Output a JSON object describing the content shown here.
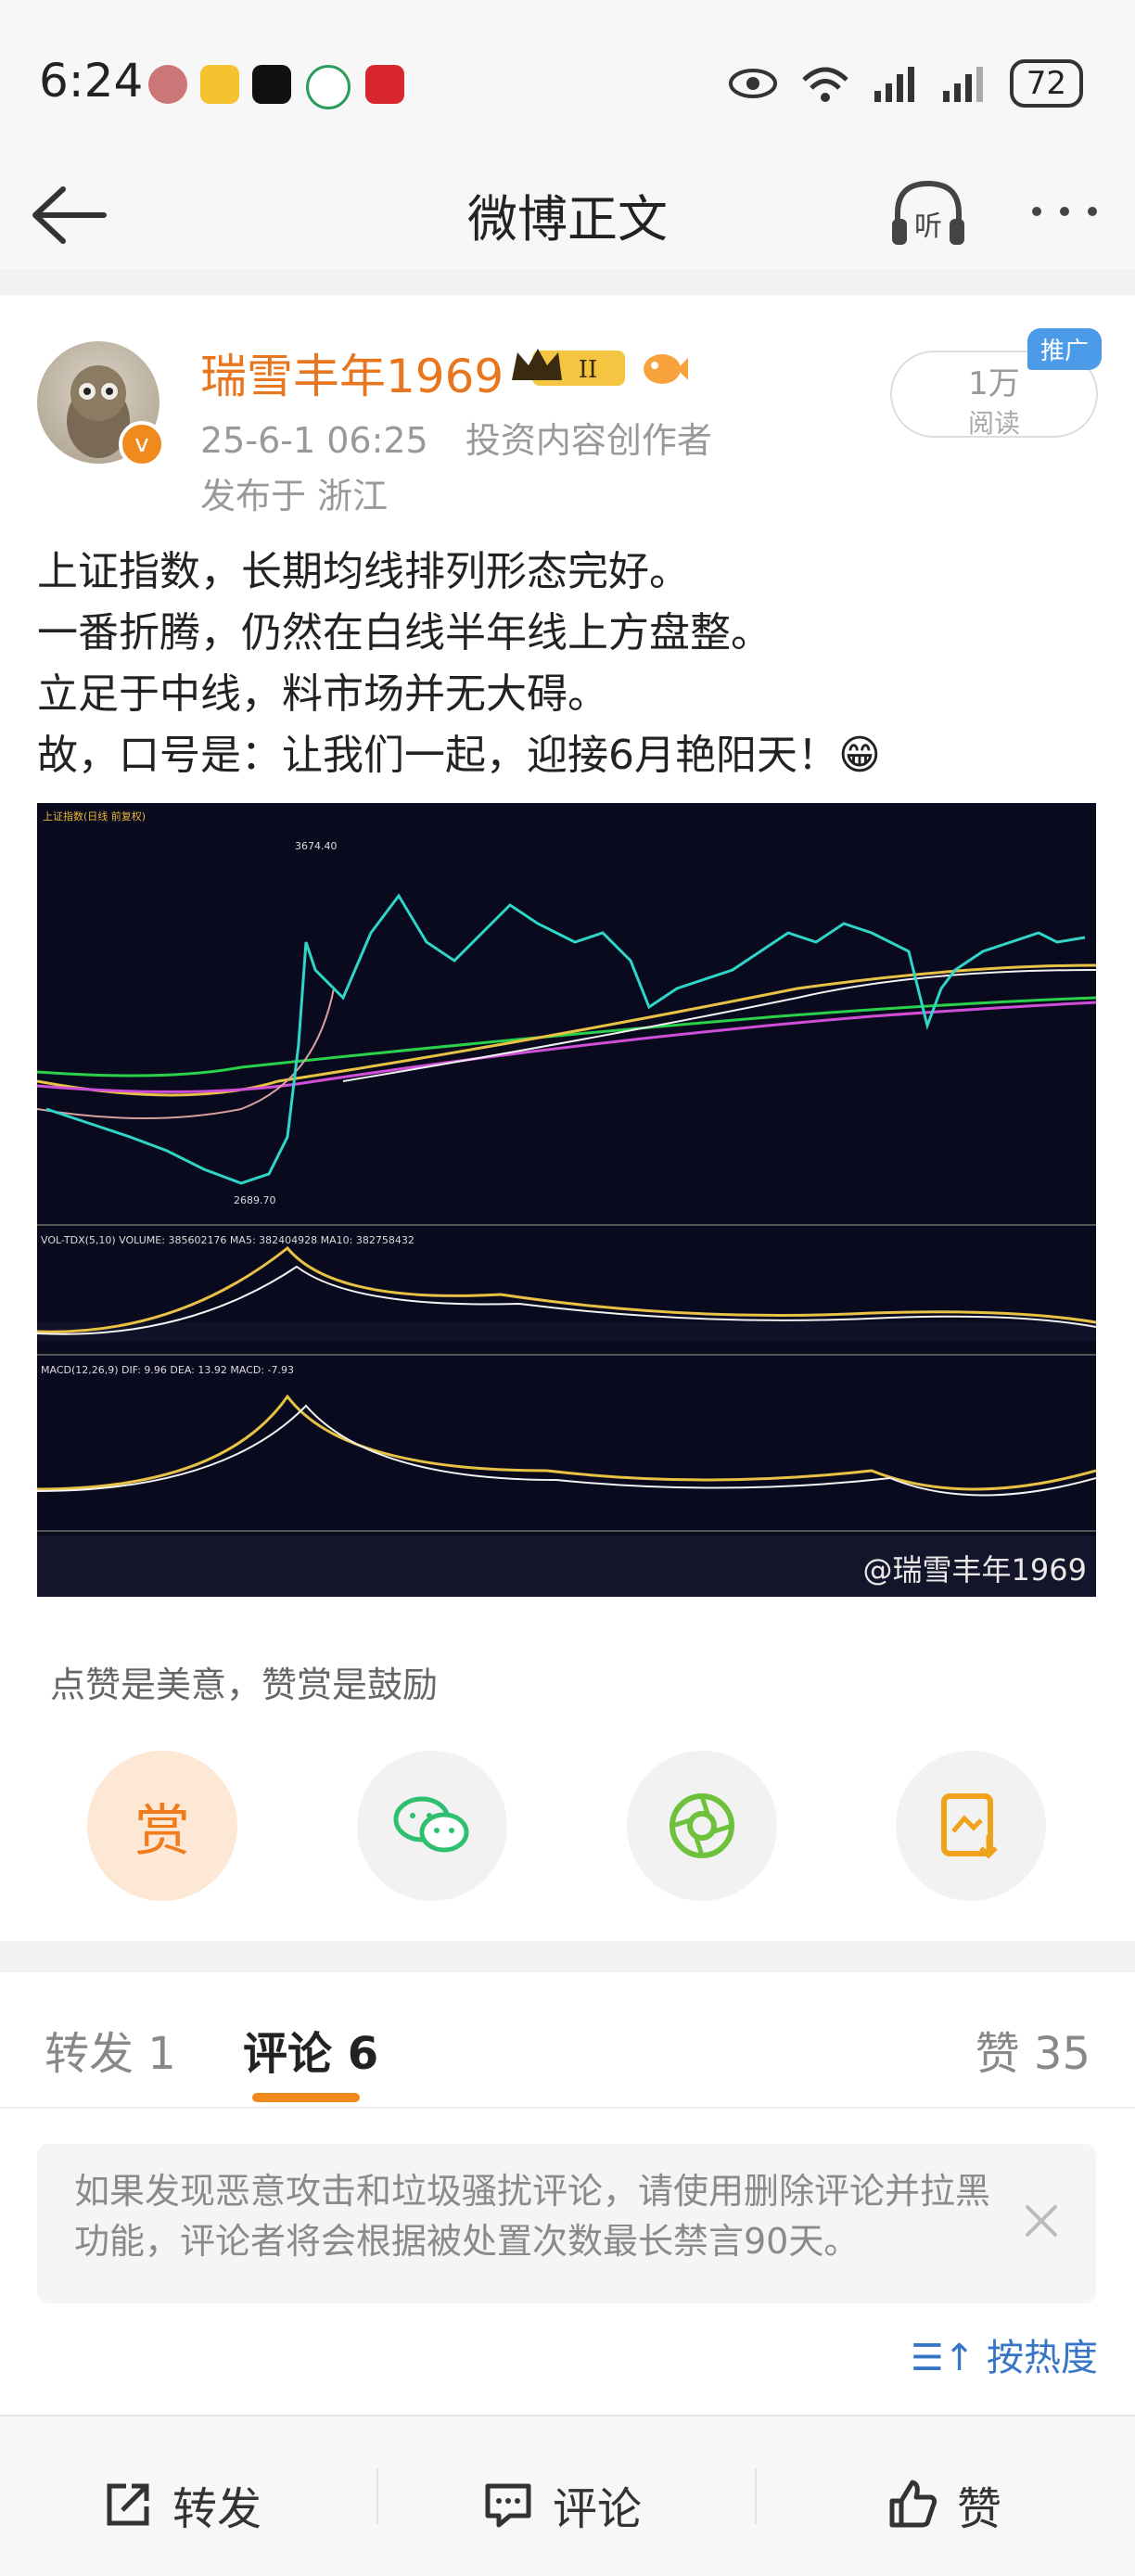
{
  "status": {
    "time": "6:24",
    "battery": "72"
  },
  "header": {
    "title": "微博正文"
  },
  "post": {
    "author": "瑞雪丰年1969",
    "level_badge": "II",
    "date": "25-6-1 06:25",
    "role": "投资内容创作者",
    "location": "发布于 浙江",
    "reads_count": "1万",
    "reads_label": "阅读",
    "promo": "推广",
    "lines": [
      "上证指数，长期均线排列形态完好。",
      "一番折腾，仍然在白线半年线上方盘整。",
      "立足于中线，料市场并无大碍。",
      "故，口号是：让我们一起，迎接6月艳阳天！😁"
    ],
    "image_watermark": "@瑞雪丰年1969",
    "chart_texts": {
      "title": "上证指数(日线 前复权)",
      "high_label": "3674.40",
      "low_label": "2689.70",
      "vol_label": "VOL-TDX(5,10) VOLUME: 385602176 MA5: 382404928 MA10: 382758432",
      "macd_label": "MACD(12,26,9) DIF: 9.96 DEA: 13.92 MACD: -7.93"
    }
  },
  "reward": {
    "tip": "点赞是美意，赞赏是鼓励",
    "reward_label": "赏"
  },
  "tabs": {
    "repost": "转发 1",
    "comment": "评论 6",
    "like": "赞 35"
  },
  "comments": {
    "notice": "如果发现恶意攻击和垃圾骚扰评论，请使用删除评论并拉黑功能，评论者将会根据被处置次数最长禁言90天。",
    "sort_label": "按热度"
  },
  "bottombar": {
    "repost": "转发",
    "comment": "评论",
    "like": "赞"
  }
}
